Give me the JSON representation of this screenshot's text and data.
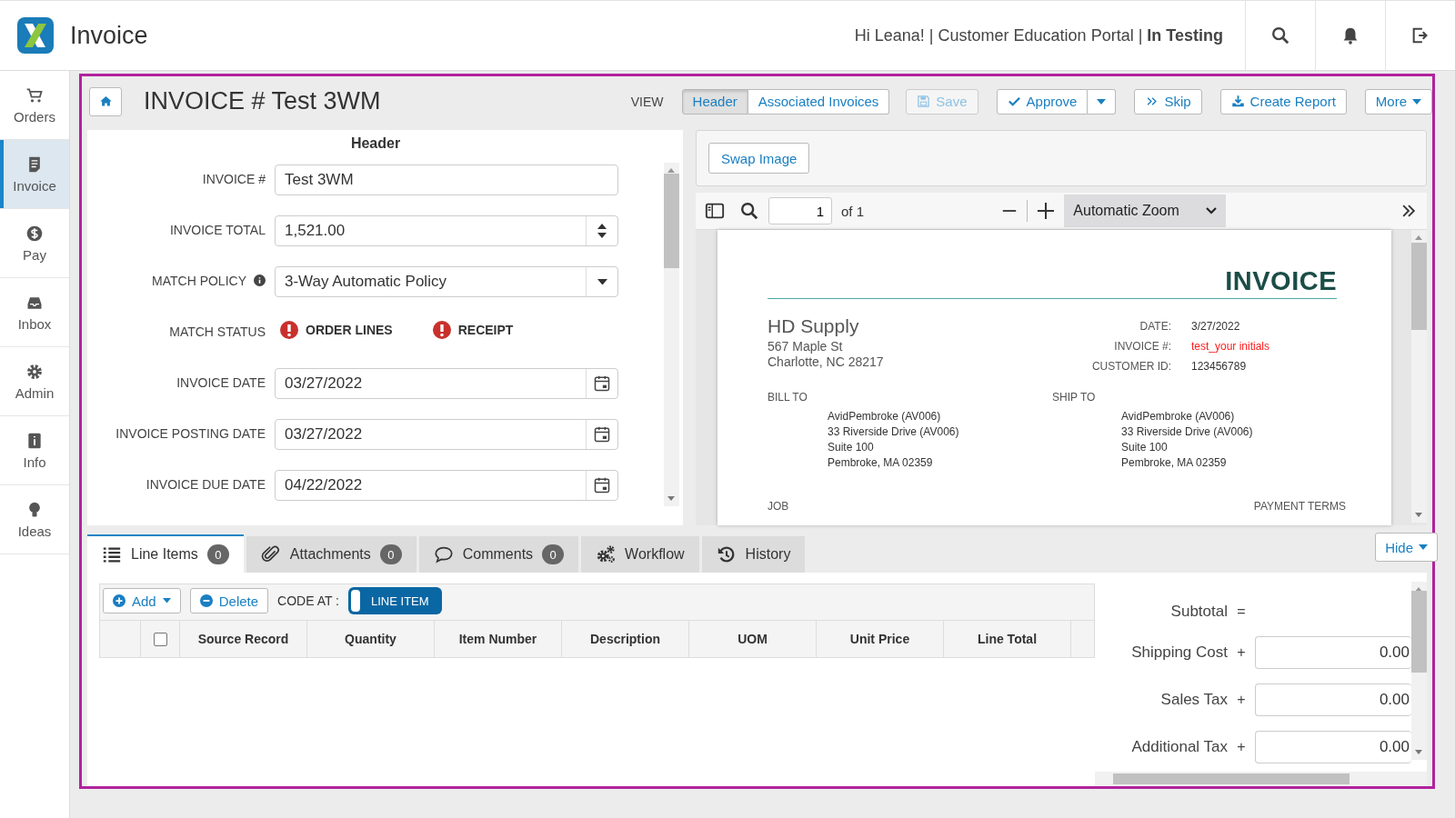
{
  "app": {
    "title": "Invoice",
    "greeting": "Hi Leana! | Customer Education Portal | **In Testing**"
  },
  "sidebar": {
    "items": [
      {
        "label": "Orders",
        "selected": false
      },
      {
        "label": "Invoice",
        "selected": true
      },
      {
        "label": "Pay",
        "selected": false
      },
      {
        "label": "Inbox",
        "selected": false
      },
      {
        "label": "Admin",
        "selected": false
      },
      {
        "label": "Info",
        "selected": false
      },
      {
        "label": "Ideas",
        "selected": false
      }
    ]
  },
  "toolbar": {
    "title": "INVOICE # Test 3WM",
    "view_label": "VIEW",
    "view_options": [
      {
        "label": "Header",
        "selected": true
      },
      {
        "label": "Associated Invoices",
        "selected": false
      }
    ],
    "buttons": [
      {
        "label": "Save",
        "disabled": true,
        "kind": "plain"
      },
      {
        "label": "Approve",
        "disabled": false,
        "kind": "split"
      },
      {
        "label": "Skip",
        "disabled": false,
        "kind": "plain"
      },
      {
        "label": "Create Report",
        "disabled": false,
        "kind": "plain"
      },
      {
        "label": "More",
        "disabled": false,
        "kind": "menu"
      }
    ]
  },
  "header_form": {
    "title": "Header",
    "fields": [
      {
        "label": "INVOICE #",
        "kind": "text",
        "value": "Test 3WM",
        "info": false
      },
      {
        "label": "INVOICE TOTAL",
        "kind": "number",
        "value": "1,521.00",
        "info": false
      },
      {
        "label": "MATCH POLICY",
        "kind": "select",
        "value": "3-Way Automatic Policy",
        "info": true
      },
      {
        "label": "MATCH STATUS",
        "kind": "status",
        "info": false,
        "items": [
          {
            "label": "ORDER LINES",
            "matched": false
          },
          {
            "label": "RECEIPT",
            "matched": false
          }
        ]
      },
      {
        "label": "INVOICE DATE",
        "kind": "date",
        "value": "03/27/2022",
        "info": false
      },
      {
        "label": "INVOICE POSTING DATE",
        "kind": "date",
        "value": "03/27/2022",
        "info": false
      },
      {
        "label": "INVOICE DUE DATE",
        "kind": "date",
        "value": "04/22/2022",
        "info": false
      }
    ]
  },
  "viewer": {
    "swap_button": "Swap Image",
    "page": "1",
    "page_count": "of 1",
    "zoom": "Automatic Zoom",
    "document": {
      "title": "INVOICE",
      "company": "HD Supply",
      "address": [
        "567 Maple St",
        "Charlotte, NC 28217"
      ],
      "meta": [
        {
          "label": "DATE:",
          "value": "3/27/2022",
          "color": "#333333"
        },
        {
          "label": "INVOICE #:",
          "value": "test_your initials",
          "color": "#ff1a1a"
        },
        {
          "label": "CUSTOMER ID:",
          "value": "123456789",
          "color": "#333333"
        }
      ],
      "bill_to": {
        "label": "BILL TO",
        "lines": [
          "AvidPembroke (AV006)",
          "33 Riverside Drive (AV006)",
          "Suite 100",
          "Pembroke, MA 02359"
        ]
      },
      "ship_to": {
        "label": "SHIP TO",
        "lines": [
          "AvidPembroke (AV006)",
          "33 Riverside Drive (AV006)",
          "Suite 100",
          "Pembroke, MA 02359"
        ]
      },
      "job_label": "JOB",
      "payment_terms_label": "PAYMENT TERMS"
    }
  },
  "tabs": [
    {
      "label": "Line Items",
      "count": "0",
      "selected": true
    },
    {
      "label": "Attachments",
      "count": "0",
      "selected": false
    },
    {
      "label": "Comments",
      "count": "0",
      "selected": false
    },
    {
      "label": "Workflow",
      "selected": false
    },
    {
      "label": "History",
      "selected": false
    }
  ],
  "line_items": {
    "add_button": "Add",
    "delete_button": "Delete",
    "code_at_label": "CODE AT :",
    "code_at_toggle": {
      "label": "LINE ITEM",
      "on": true
    },
    "select_all_checked": false,
    "columns": [
      "Source Record",
      "Quantity",
      "Item Number",
      "Description",
      "UOM",
      "Unit Price",
      "Line Total"
    ]
  },
  "totals": {
    "hide_button": "Hide",
    "rows": [
      {
        "label": "Subtotal",
        "operator": "=",
        "kind": "plain"
      },
      {
        "label": "Shipping Cost",
        "operator": "+",
        "kind": "input",
        "value": "0.00"
      },
      {
        "label": "Sales Tax",
        "operator": "+",
        "kind": "input",
        "value": "0.00"
      },
      {
        "label": "Additional Tax",
        "operator": "+",
        "kind": "input",
        "value": "0.00"
      }
    ]
  }
}
